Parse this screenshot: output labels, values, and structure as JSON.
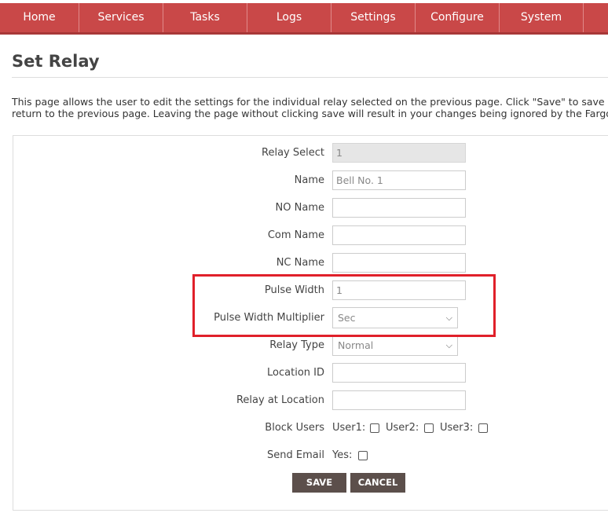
{
  "nav": {
    "items": [
      {
        "label": "Home"
      },
      {
        "label": "Services"
      },
      {
        "label": "Tasks"
      },
      {
        "label": "Logs"
      },
      {
        "label": "Settings"
      },
      {
        "label": "Configure"
      },
      {
        "label": "System"
      }
    ]
  },
  "page": {
    "title": "Set Relay",
    "description_line1": "This page allows the user to edit the settings for the individual relay selected on the previous page. Click \"Save\" to save chan",
    "description_line2": "return to the previous page. Leaving the page without clicking save will result in your changes being ignored by the Fargo ser"
  },
  "form": {
    "relay_select": {
      "label": "Relay Select",
      "value": "1"
    },
    "name": {
      "label": "Name",
      "placeholder": "Bell No. 1"
    },
    "no_name": {
      "label": "NO Name",
      "value": ""
    },
    "com_name": {
      "label": "Com Name",
      "value": ""
    },
    "nc_name": {
      "label": "NC Name",
      "value": ""
    },
    "pulse_width": {
      "label": "Pulse Width",
      "placeholder": "1"
    },
    "pulse_width_multiplier": {
      "label": "Pulse Width Multiplier",
      "selected": "Sec"
    },
    "relay_type": {
      "label": "Relay Type",
      "selected": "Normal"
    },
    "location_id": {
      "label": "Location ID",
      "value": ""
    },
    "relay_at_location": {
      "label": "Relay at Location",
      "value": ""
    },
    "block_users": {
      "label": "Block Users",
      "user1": "User1:",
      "user2": "User2:",
      "user3": "User3:"
    },
    "send_email": {
      "label": "Send Email",
      "yes": "Yes:"
    }
  },
  "buttons": {
    "save": "SAVE",
    "cancel": "CANCEL"
  },
  "colors": {
    "nav": "#c94848",
    "highlight": "#e0202a",
    "button": "#5c4f4b"
  }
}
